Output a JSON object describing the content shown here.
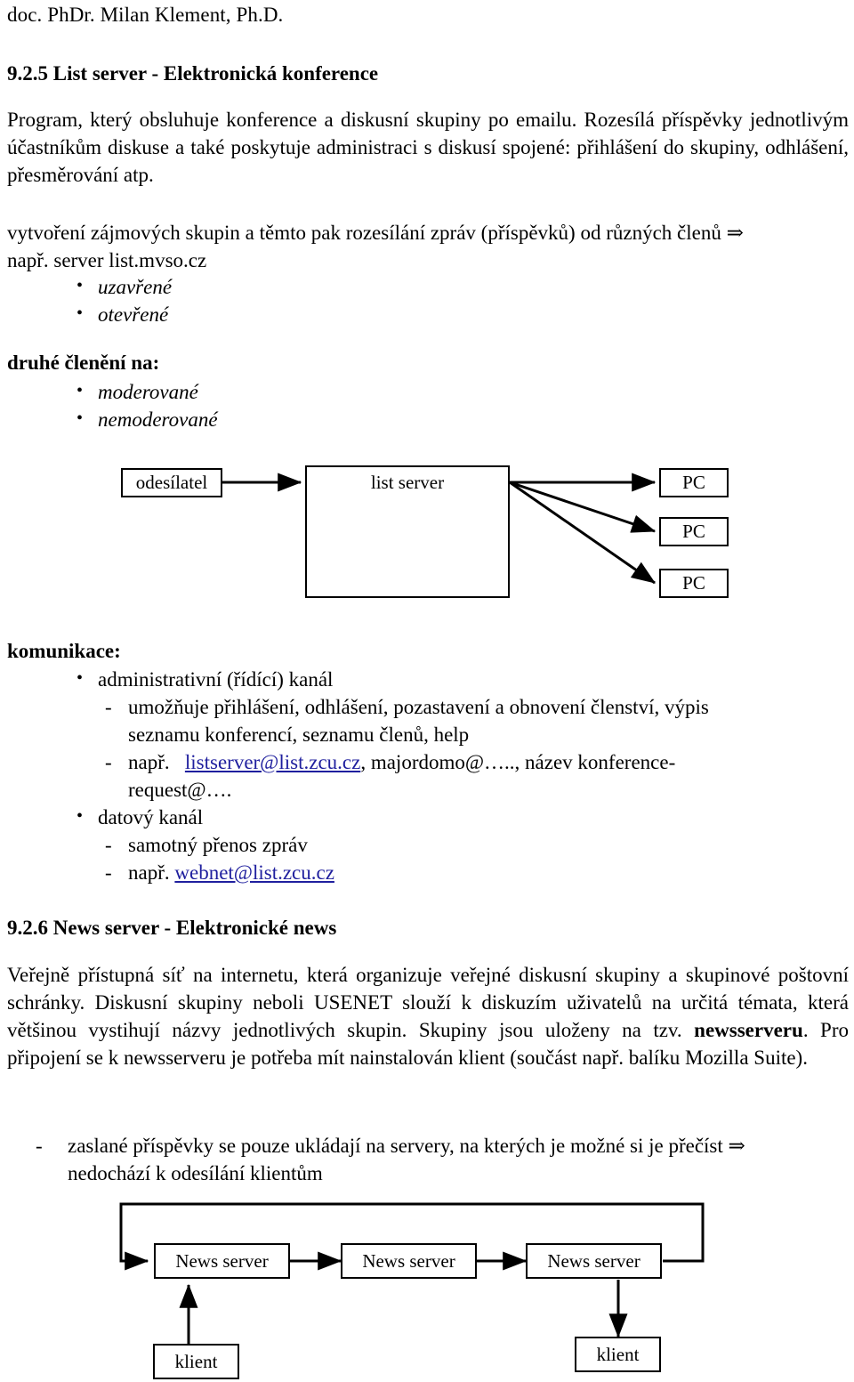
{
  "document": {
    "running_head": "doc. PhDr. Milan Klement, Ph.D."
  },
  "sections": {
    "list_server": {
      "heading": "9.2.5 List server - Elektronická konference",
      "intro_paragraph": "Program, který obsluhuje konference a diskusní skupiny po emailu. Rozesílá příspěvky jednotlivým účastníkům diskuse a také poskytuje administraci s diskusí spojené: přihlášení do skupiny, odhlášení, přesměrování atp.",
      "vytvoreni_line1": "vytvoření zájmových skupin a těmto pak rozesílání zpráv (příspěvků) od různých členů ⇒",
      "vytvoreni_line2": "např. server list.mvso.cz",
      "typy_items": [
        "uzavřené",
        "otevřené"
      ],
      "druhe_cleneni_label": "druhé členění na:",
      "cleneni_items": [
        "moderované",
        "nemoderované"
      ],
      "komunikace_label": "komunikace:",
      "komunikace": {
        "bullet1": "administrativní (řídící) kanál",
        "bullet1_dash1_line1": "umožňuje přihlášení, odhlášení, pozastavení a obnovení členství, výpis",
        "bullet1_dash1_line2": "seznamu konferencí, seznamu členů, help",
        "bullet1_dash2_prefix": "např.",
        "bullet1_dash2_link": "listserver@list.zcu.cz",
        "bullet1_dash2_rest": ", majordomo@….., název konference-",
        "bullet1_dash2_line2": "request@….",
        "bullet2": "datový kanál",
        "bullet2_dash1": "samotný přenos zpráv",
        "bullet2_dash2_prefix": "např.",
        "bullet2_dash2_link": "webnet@list.zcu.cz"
      }
    },
    "news_server": {
      "heading": "9.2.6 News server - Elektronické news",
      "paragraph_part1": "Veřejně přístupná síť na internetu, která organizuje veřejné diskusní skupiny a skupinové poštovní schránky. Diskusní skupiny neboli USENET slouží k diskuzím uživatelů na určitá témata, která většinou vystihují názvy jednotlivých skupin. Skupiny jsou uloženy na tzv. ",
      "paragraph_bold": "newsserveru",
      "paragraph_part2": ". Pro připojení se k newsserveru je potřeba mít nainstalován klient (součást např. balíku Mozilla Suite).",
      "zaslane_line1": "zaslané příspěvky se pouze ukládají na servery, na kterých je možné si je přečíst ⇒",
      "zaslane_line2": "nedochází k odesílání klientům"
    }
  },
  "diagrams": {
    "list_server_diagram": {
      "sender_label": "odesílatel",
      "server_label": "list server",
      "server_column_count": 6,
      "client_labels": [
        "PC",
        "PC",
        "PC"
      ]
    },
    "news_server_diagram": {
      "server_labels": [
        "News server",
        "News server",
        "News server"
      ],
      "client_labels": [
        "klient",
        "klient"
      ]
    }
  },
  "colors": {
    "link": "#1f1f9e",
    "text": "#000000",
    "background": "#ffffff",
    "stroke": "#000000"
  }
}
